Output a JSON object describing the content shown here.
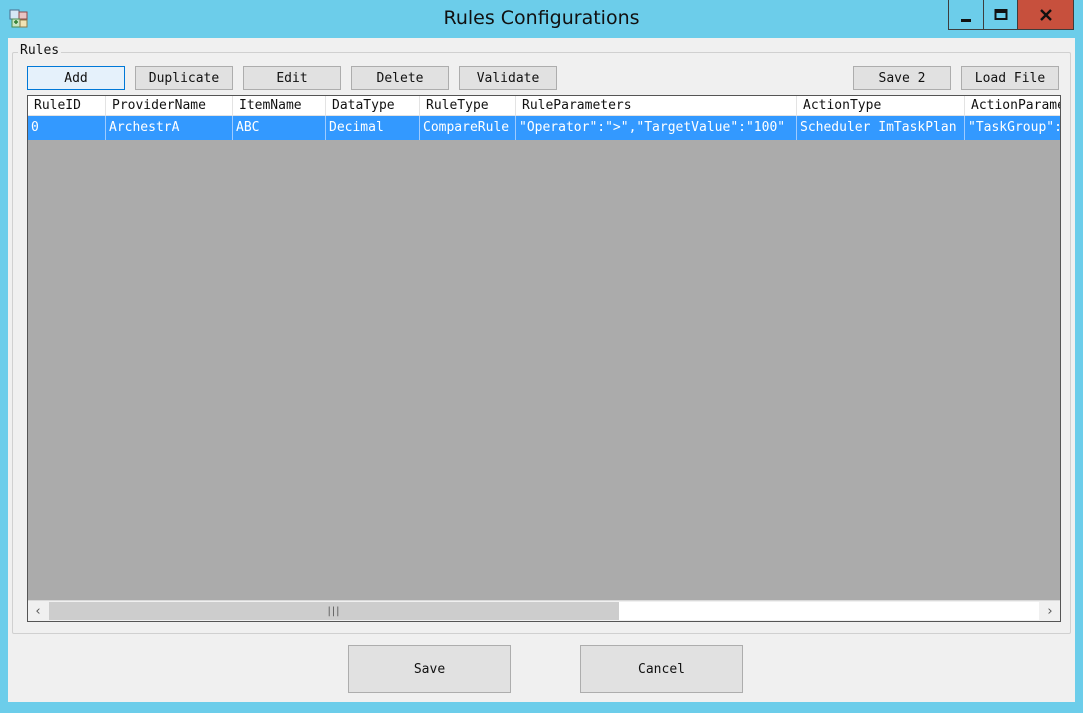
{
  "window": {
    "title": "Rules Configurations",
    "icon": "app-icon",
    "controls": {
      "minimize": "minimize-icon",
      "maximize": "maximize-icon",
      "close": "close-icon",
      "close_color": "#c7503d"
    }
  },
  "group": {
    "label": "Rules"
  },
  "toolbar": {
    "add_label": "Add",
    "duplicate_label": "Duplicate",
    "edit_label": "Edit",
    "delete_label": "Delete",
    "validate_label": "Validate",
    "save2_label": "Save 2",
    "loadfile_label": "Load File"
  },
  "grid": {
    "columns": [
      "RuleID",
      "ProviderName",
      "ItemName",
      "DataType",
      "RuleType",
      "RuleParameters",
      "ActionType",
      "ActionParameters"
    ],
    "rows": [
      {
        "selected": true,
        "cells": [
          "0",
          "ArchestrA",
          "ABC",
          "Decimal",
          "CompareRule",
          "\"Operator\":\">\",\"TargetValue\":\"100\"",
          "Scheduler ImTaskPlan",
          "\"TaskGroup\":"
        ]
      }
    ],
    "selection_color": "#3399ff",
    "empty_area_color": "#ababab"
  },
  "footer": {
    "save_label": "Save",
    "cancel_label": "Cancel"
  },
  "colors": {
    "titlebar": "#6ccdea",
    "client": "#f0f0f0"
  }
}
